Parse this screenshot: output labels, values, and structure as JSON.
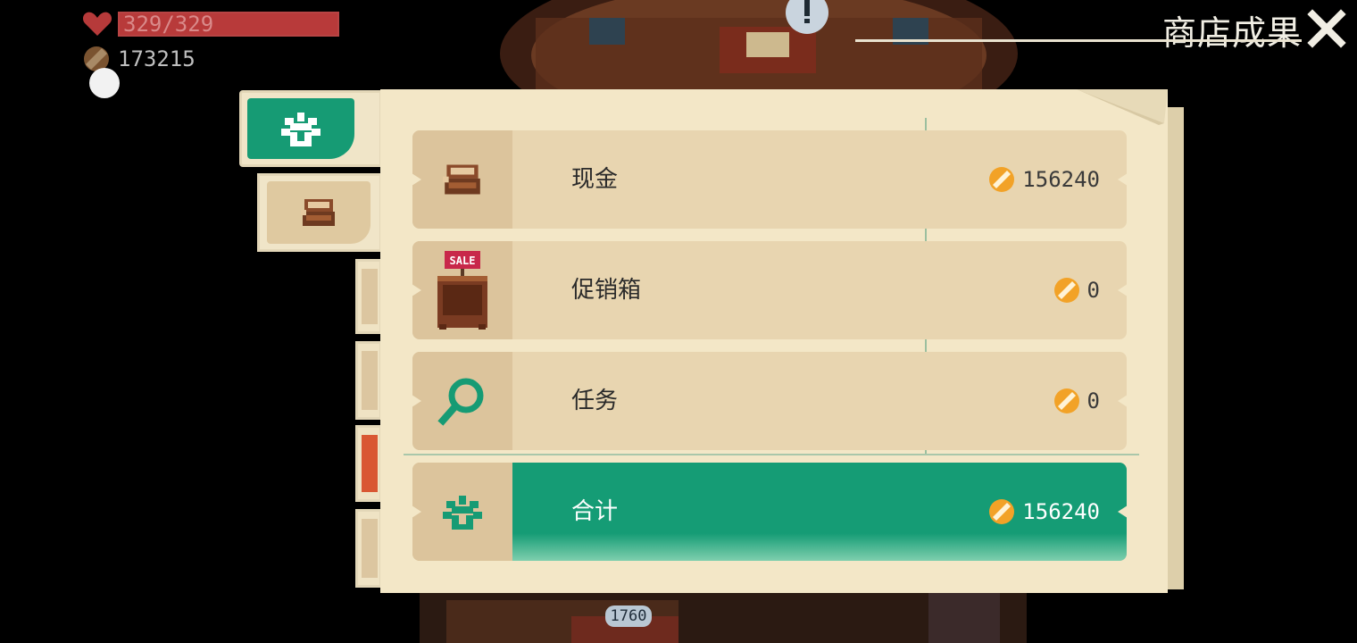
{
  "hud": {
    "hp_text": "329/329",
    "hp_fraction": 1.0,
    "gold_amount": "173215"
  },
  "header": {
    "title": "商店成果"
  },
  "tabs": [
    {
      "icon": "sprout-icon",
      "active": true
    },
    {
      "icon": "cash-register-icon",
      "active": false
    }
  ],
  "rows": [
    {
      "label": "现金",
      "value": "156240",
      "icon": "cash-register-icon"
    },
    {
      "label": "促销箱",
      "value": "0",
      "icon": "sale-box-icon",
      "sign": "SALE"
    },
    {
      "label": "任务",
      "value": "0",
      "icon": "magnifier-icon"
    }
  ],
  "total": {
    "label": "合计",
    "value": "156240",
    "icon": "sprout-icon"
  },
  "background": {
    "floor_label": "1760"
  },
  "colors": {
    "accent_green": "#159c75",
    "panel": "#f3e7c7",
    "hp_red": "#9a2f2f",
    "coin_orange": "#f2a227"
  }
}
